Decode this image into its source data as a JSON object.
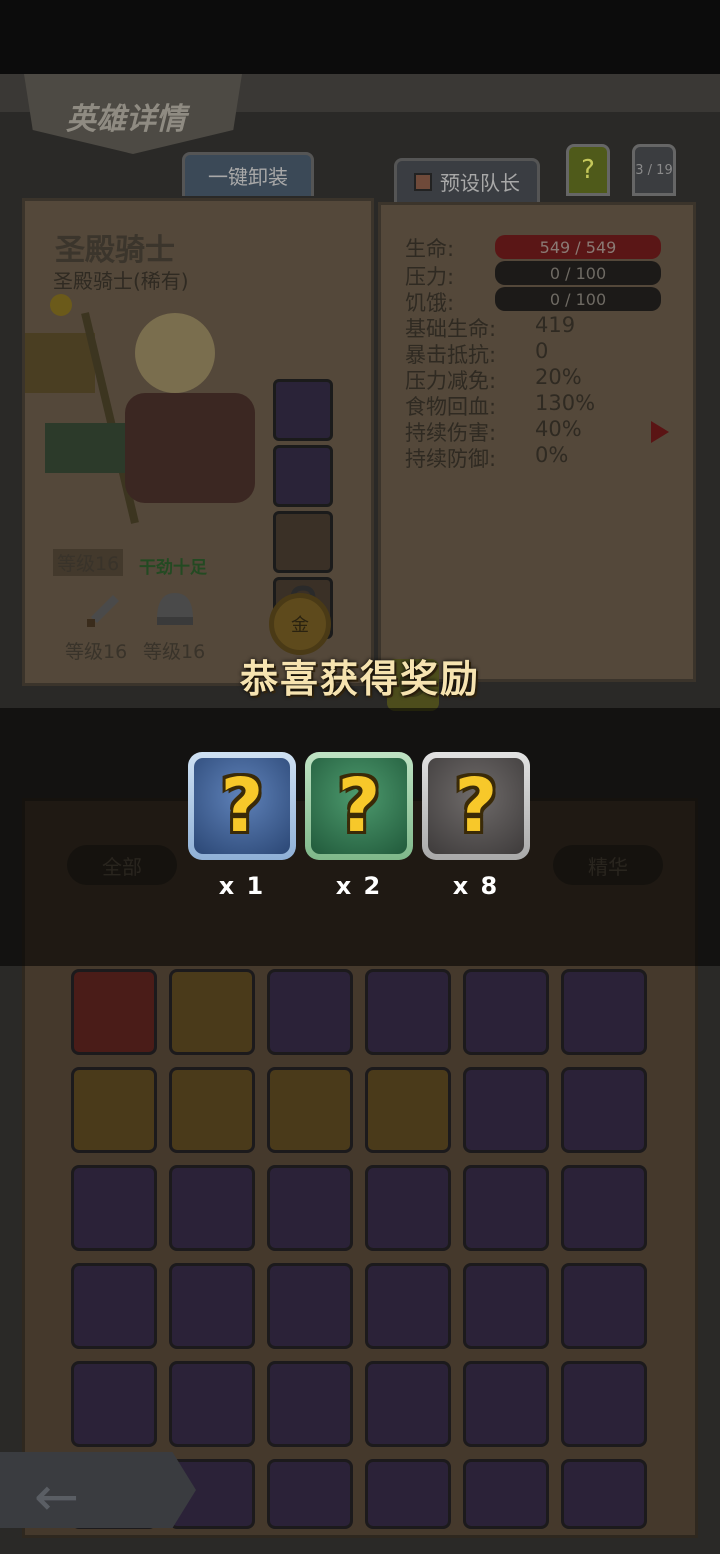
{
  "header": {
    "title": "英雄详情",
    "unequip_all": "一键卸装",
    "preset_leader": "预设队长",
    "help": "?",
    "page_count": "3 / 19"
  },
  "hero": {
    "name": "圣殿骑士",
    "class_line": "圣殿骑士(稀有)",
    "level_badge": "等级16",
    "mood": "干劲十足",
    "weapon_level": "等级16",
    "armor_level": "等级16",
    "gold_label": "金",
    "trinket_caption": "干劲十足"
  },
  "stats": [
    {
      "label": "生命:",
      "value": "549 / 549"
    },
    {
      "label": "压力:",
      "value": "0 / 100"
    },
    {
      "label": "饥饿:",
      "value": "0 / 100"
    },
    {
      "label": "基础生命:",
      "value": "419"
    },
    {
      "label": "暴击抵抗:",
      "value": "0"
    },
    {
      "label": "压力减免:",
      "value": "20%"
    },
    {
      "label": "食物回血:",
      "value": "130%"
    },
    {
      "label": "持续伤害:",
      "value": "40%"
    },
    {
      "label": "持续防御:",
      "value": "0%"
    }
  ],
  "inventory_filters": {
    "all": "全部",
    "essence": "精华"
  },
  "reward_popup": {
    "title": "恭喜获得奖励",
    "items": [
      {
        "icon": "question-mark-icon",
        "rarity": "blue",
        "quantity": "x 1"
      },
      {
        "icon": "question-mark-icon",
        "rarity": "green",
        "quantity": "x 2"
      },
      {
        "icon": "question-mark-icon",
        "rarity": "grey",
        "quantity": "x 8"
      }
    ]
  },
  "colors": {
    "accent_gold": "#f7c82a",
    "title_text": "#f6e3b0"
  }
}
